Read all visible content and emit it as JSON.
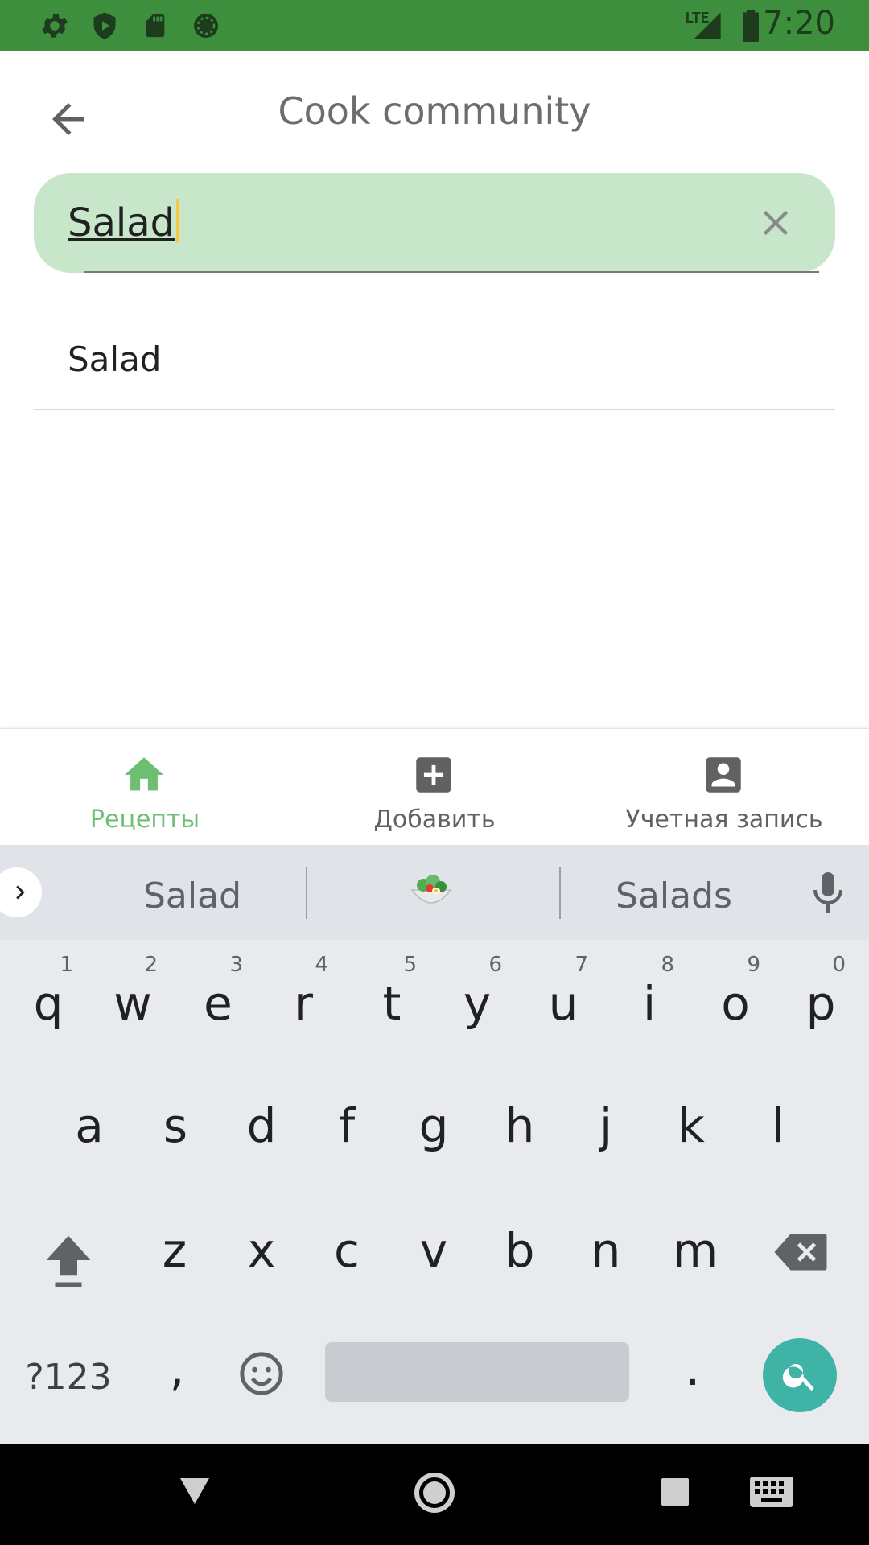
{
  "status_bar": {
    "time": "7:20",
    "network": "LTE",
    "icons": [
      "gear-icon",
      "shield-play-icon",
      "sd-card-icon",
      "sync-circle-icon",
      "signal-icon",
      "battery-icon"
    ],
    "background": "#3d8f3d"
  },
  "app_bar": {
    "title": "Cook community",
    "back_icon": "arrow-back-icon"
  },
  "search": {
    "value": "Salad",
    "clear_icon": "close-icon",
    "background": "#c8e6c9"
  },
  "suggestions": [
    "Salad"
  ],
  "bottom_nav": {
    "items": [
      {
        "label": "Рецепты",
        "icon": "home-icon",
        "active": true
      },
      {
        "label": "Добавить",
        "icon": "add-box-icon",
        "active": false
      },
      {
        "label": "Учетная запись",
        "icon": "account-box-icon",
        "active": false
      }
    ],
    "active_color": "#6fbf73"
  },
  "keyboard": {
    "suggestions": [
      "Salad",
      "🥗",
      "Salads"
    ],
    "row1": [
      "q",
      "w",
      "e",
      "r",
      "t",
      "y",
      "u",
      "i",
      "o",
      "p"
    ],
    "row1_numbers": [
      "1",
      "2",
      "3",
      "4",
      "5",
      "6",
      "7",
      "8",
      "9",
      "0"
    ],
    "row2": [
      "a",
      "s",
      "d",
      "f",
      "g",
      "h",
      "j",
      "k",
      "l"
    ],
    "row3": [
      "z",
      "x",
      "c",
      "v",
      "b",
      "n",
      "m"
    ],
    "bottom": {
      "symbols": "?123",
      "comma": ",",
      "period": "."
    },
    "action_color": "#3fb3a6"
  }
}
